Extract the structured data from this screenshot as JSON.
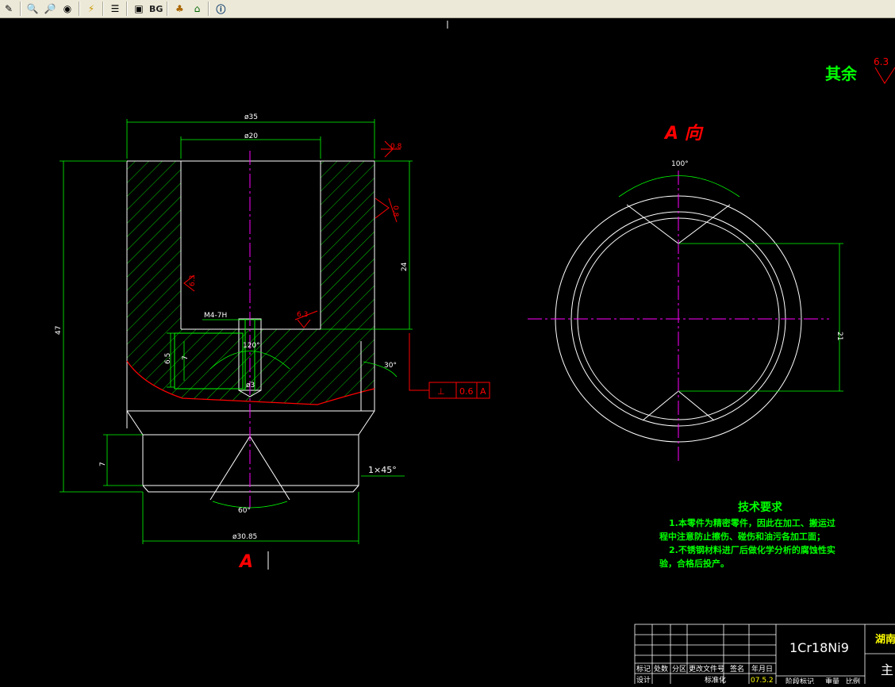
{
  "toolbar": {
    "bg_label": "BG",
    "colors": {
      "background": "#ece9d8",
      "separator": "#aca899"
    }
  },
  "drawing": {
    "colors": {
      "background": "#000000",
      "geometry": "#ffffff",
      "dimension": "#00ff00",
      "centerline": "#ff00ff",
      "annotation": "#ff0000",
      "text_yellow": "#ffff00",
      "note": "#00ff00"
    },
    "surface_finish_note": {
      "label": "其余",
      "value": "6.3"
    },
    "view_label": "A 向",
    "section_label": "A",
    "dims": {
      "d_outer": "ø35",
      "d_inner": "ø20",
      "height_total": "47",
      "height_bore": "24",
      "thread": "M4-7H",
      "depth1": "6.5",
      "depth2": "7",
      "drill_angle": "120°",
      "drill_dia": "ø3",
      "chamfer_angle": "30°",
      "flange_height": "7",
      "chamfer": "1×45°",
      "cone_angle": "60°",
      "d_bottom": "ø30.85",
      "view_angle": "100°",
      "view_width": "21"
    },
    "roughness": {
      "r1": "0.8",
      "r2": "6.3",
      "r3": "6.3",
      "r4": "0.8"
    },
    "tolerance": {
      "symbol": "⊥",
      "value": "0.6",
      "datum": "A"
    }
  },
  "notes": {
    "title": "技术要求",
    "lines": [
      "1.本零件为精密零件，因此在加工、搬运过",
      "程中注意防止擦伤、碰伤和油污各加工面；",
      "2.不锈钢材料进厂后做化学分析的腐蚀性实",
      "验，合格后投产。"
    ]
  },
  "title_block": {
    "material": "1Cr18Ni9",
    "headers": [
      "标记",
      "处数",
      "分区",
      "更改文件号",
      "签名",
      "年月日"
    ],
    "row2": [
      "设计",
      "",
      "标准化"
    ],
    "date": "07.5.2",
    "corner_text": "湖南",
    "main": "主",
    "bottom_labels": [
      "阶段标记",
      "重量",
      "比例"
    ]
  }
}
